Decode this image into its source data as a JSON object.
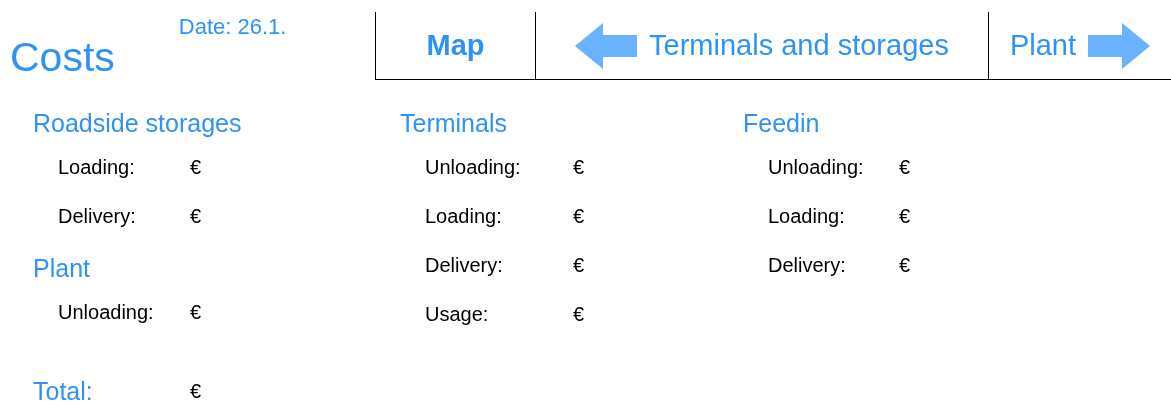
{
  "title": "Costs",
  "date": "Date: 26.1.",
  "nav": [
    {
      "label": "Map",
      "selected": true,
      "kind": "plain"
    },
    {
      "label": "Terminals and storages",
      "selected": false,
      "kind": "back"
    },
    {
      "label": "Plant",
      "selected": false,
      "kind": "forward"
    }
  ],
  "columns": [
    {
      "sections": [
        {
          "heading": "Roadside storages",
          "rows": [
            {
              "label": "Loading:",
              "value": "€"
            },
            {
              "label": "Delivery:",
              "value": "€"
            }
          ]
        },
        {
          "heading": "Plant",
          "rows": [
            {
              "label": "Unloading:",
              "value": "€"
            }
          ]
        }
      ]
    },
    {
      "sections": [
        {
          "heading": "Terminals",
          "rows": [
            {
              "label": "Unloading:",
              "value": "€"
            },
            {
              "label": "Loading:",
              "value": "€"
            },
            {
              "label": "Delivery:",
              "value": "€"
            },
            {
              "label": "Usage:",
              "value": "€"
            }
          ]
        }
      ]
    },
    {
      "sections": [
        {
          "heading": "Feedin",
          "rows": [
            {
              "label": "Unloading:",
              "value": "€"
            },
            {
              "label": "Loading:",
              "value": "€"
            },
            {
              "label": "Delivery:",
              "value": "€"
            }
          ]
        }
      ]
    }
  ],
  "total": {
    "label": "Total:",
    "value": "€"
  }
}
